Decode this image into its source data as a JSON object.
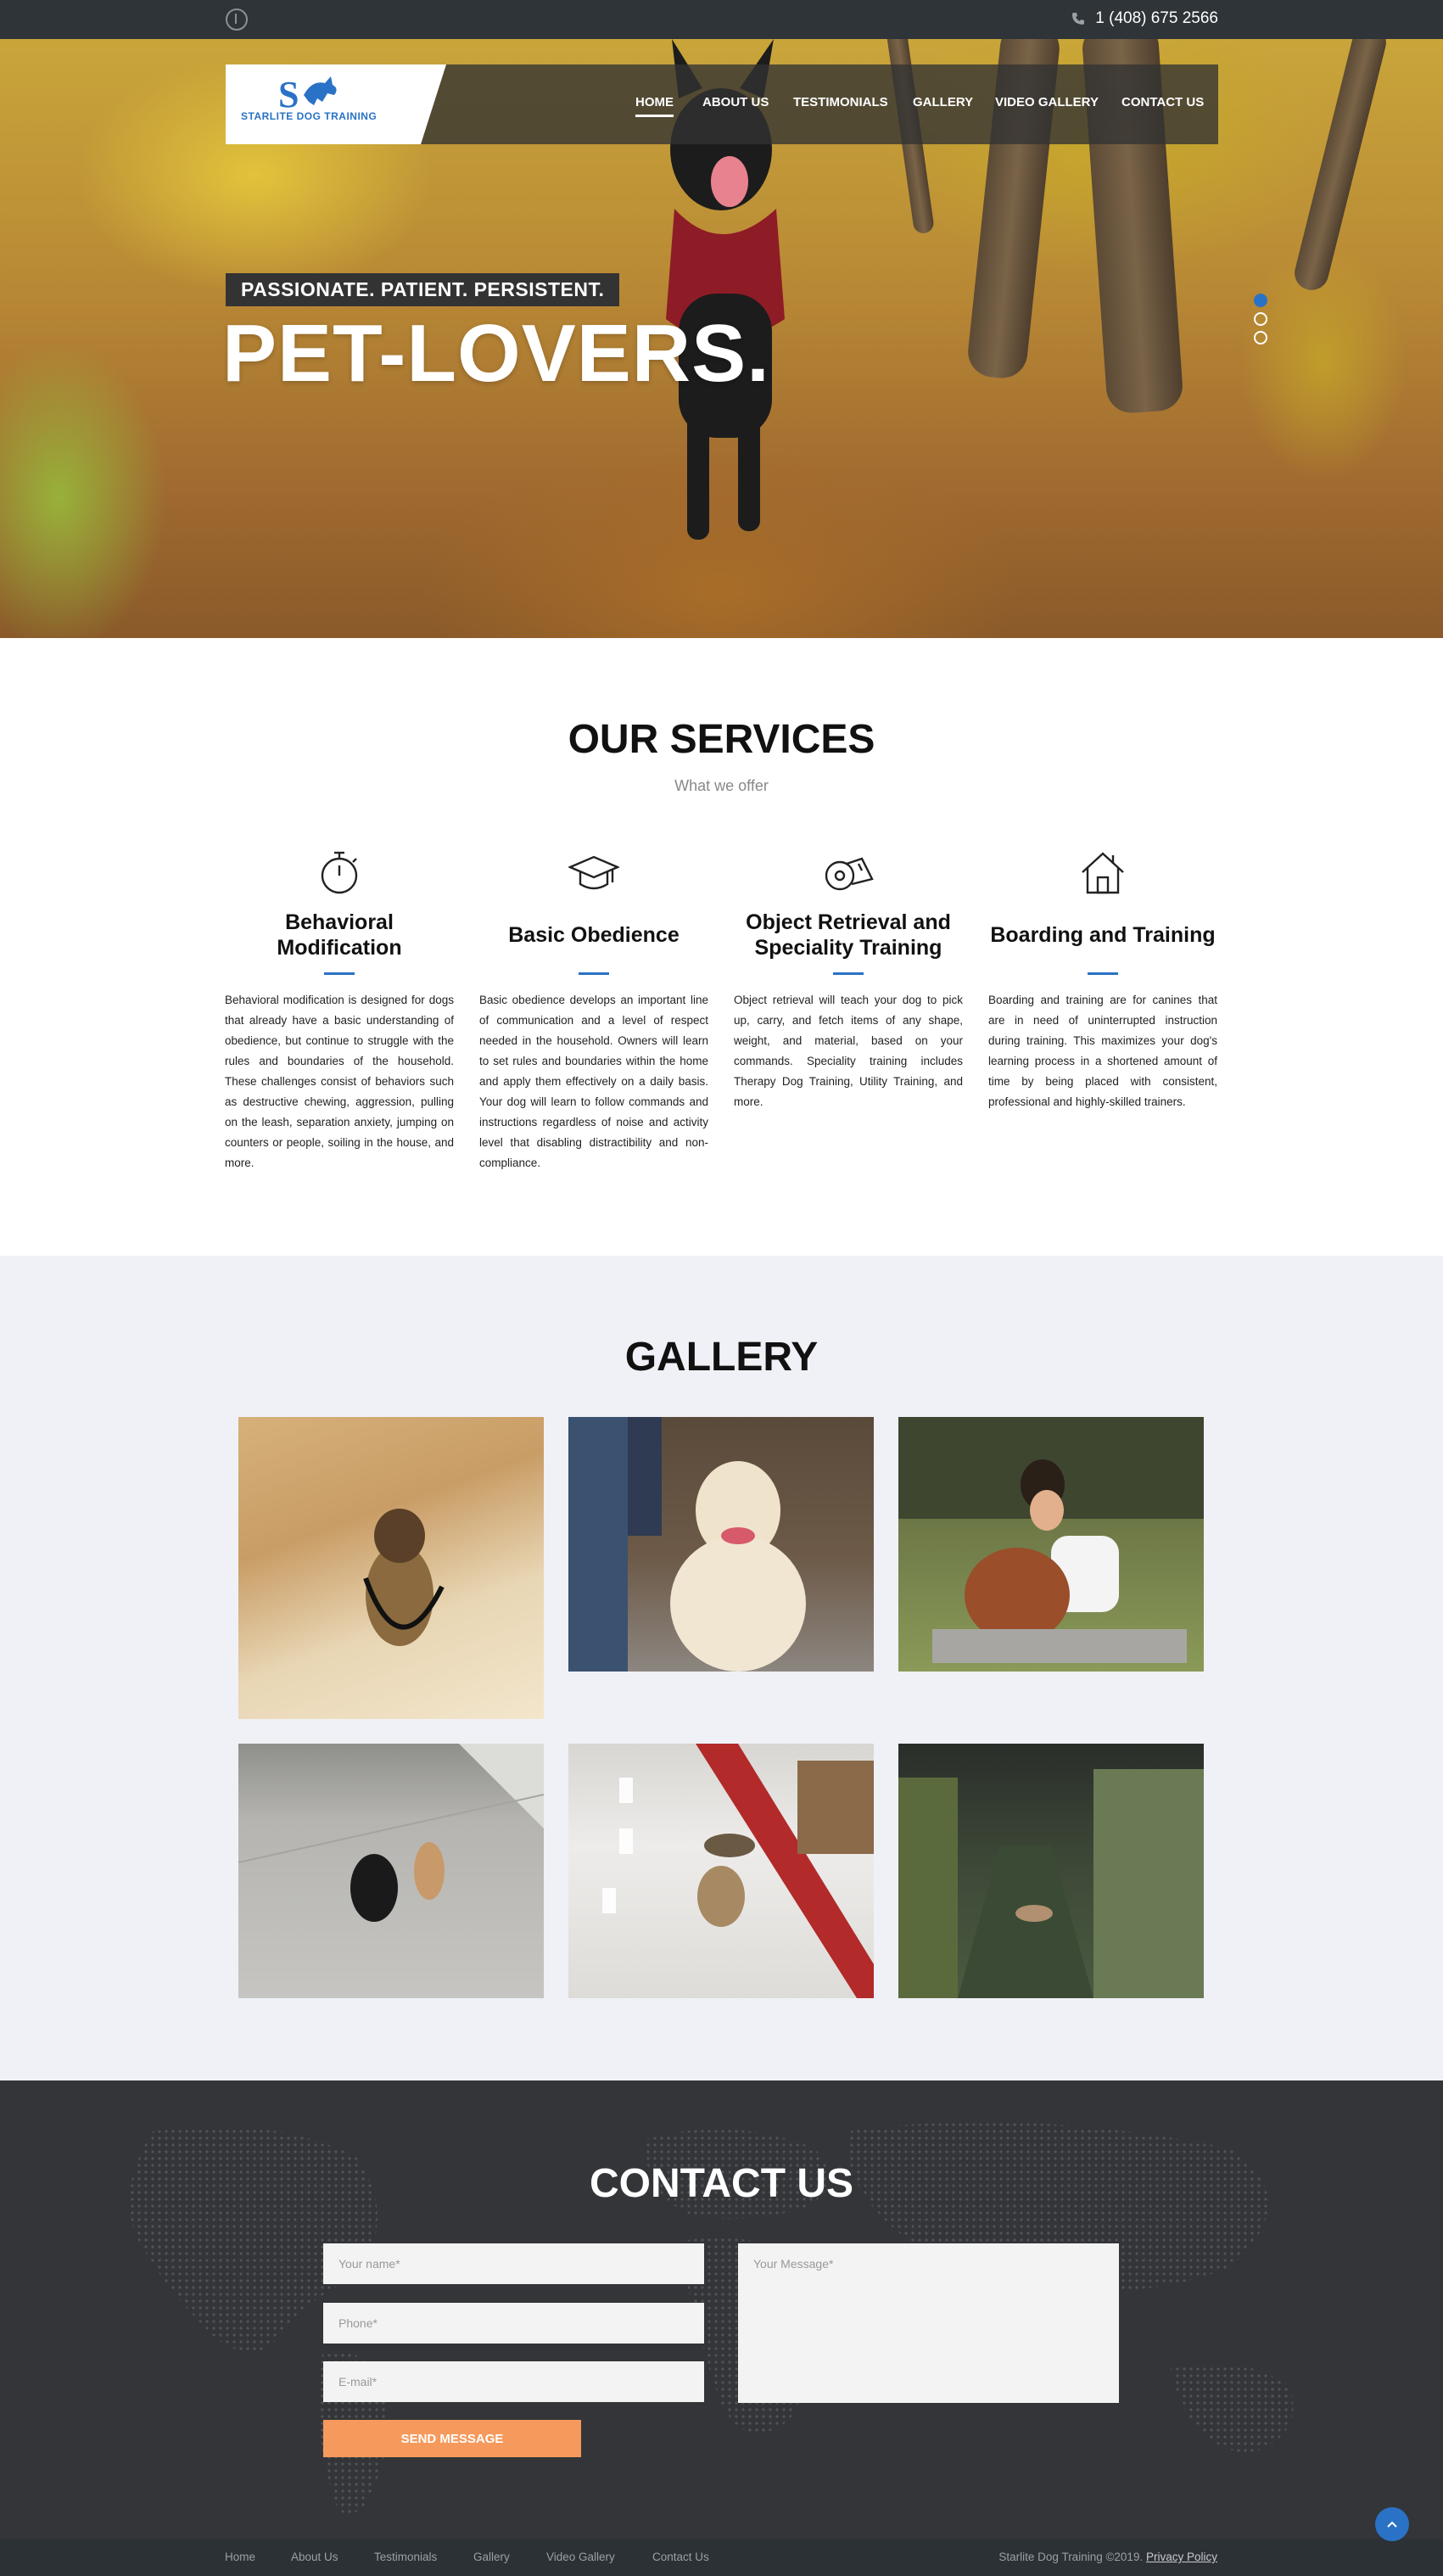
{
  "topbar": {
    "accessibility_icon": "accessibility-icon",
    "phone_icon": "phone-icon",
    "phone": "1 (408) 675 2566"
  },
  "header": {
    "logo_text": "STARLITE DOG TRAINING",
    "nav": [
      {
        "label": "HOME",
        "active": true
      },
      {
        "label": "ABOUT US"
      },
      {
        "label": "TESTIMONIALS"
      },
      {
        "label": "GALLERY"
      },
      {
        "label": "VIDEO GALLERY"
      },
      {
        "label": "CONTACT US"
      }
    ]
  },
  "hero": {
    "tagline": "PASSIONATE. PATIENT. PERSISTENT.",
    "title": "PET-LOVERS.",
    "slides": 3,
    "active_slide": 1
  },
  "services": {
    "title": "OUR SERVICES",
    "subtitle": "What we offer",
    "items": [
      {
        "icon": "stopwatch-icon",
        "title": "Behavioral Modification",
        "text": "Behavioral modification is designed for dogs that already have a basic understanding of obedience, but continue to struggle with the rules and boundaries of the household. These challenges consist of behaviors such as destructive chewing, aggression, pulling on the leash, separation anxiety, jumping on counters or people, soiling in the house, and more."
      },
      {
        "icon": "graduation-cap-icon",
        "title": "Basic Obedience",
        "text": "Basic obedience develops an important line of communication and a level of respect needed in the household. Owners will learn to set rules and boundaries within the home and apply them effectively on a daily basis. Your dog will learn to follow commands and instructions regardless of noise and activity level that disabling distractibility and non-compliance."
      },
      {
        "icon": "whistle-icon",
        "title": "Object Retrieval and Speciality Training",
        "text": "Object retrieval will teach your dog to pick up, carry, and fetch items of any shape, weight, and material, based on your commands. Speciality training includes Therapy Dog Training, Utility Training, and more."
      },
      {
        "icon": "house-icon",
        "title": "Boarding and Training",
        "text": "Boarding and training are for canines that are in need of uninterrupted instruction during training. This maximizes your dog's learning process in a shortened amount of time by being placed with consistent, professional and highly-skilled trainers."
      }
    ]
  },
  "gallery": {
    "title": "GALLERY"
  },
  "contact": {
    "title": "CONTACT US",
    "name_placeholder": "Your name*",
    "phone_placeholder": "Phone*",
    "email_placeholder": "E-mail*",
    "message_placeholder": "Your Message*",
    "send_label": "SEND MESSAGE"
  },
  "footer": {
    "links": [
      "Home",
      "About Us",
      "Testimonials",
      "Gallery",
      "Video Gallery",
      "Contact Us"
    ],
    "copyright": "Starlite Dog Training ©2019.",
    "privacy": "Privacy Policy"
  },
  "colors": {
    "accent": "#2a72c6",
    "button": "#f59a5c",
    "topbar": "#2f3439",
    "contact_bg": "#333538",
    "gallery_bg": "#f0f1f7"
  }
}
